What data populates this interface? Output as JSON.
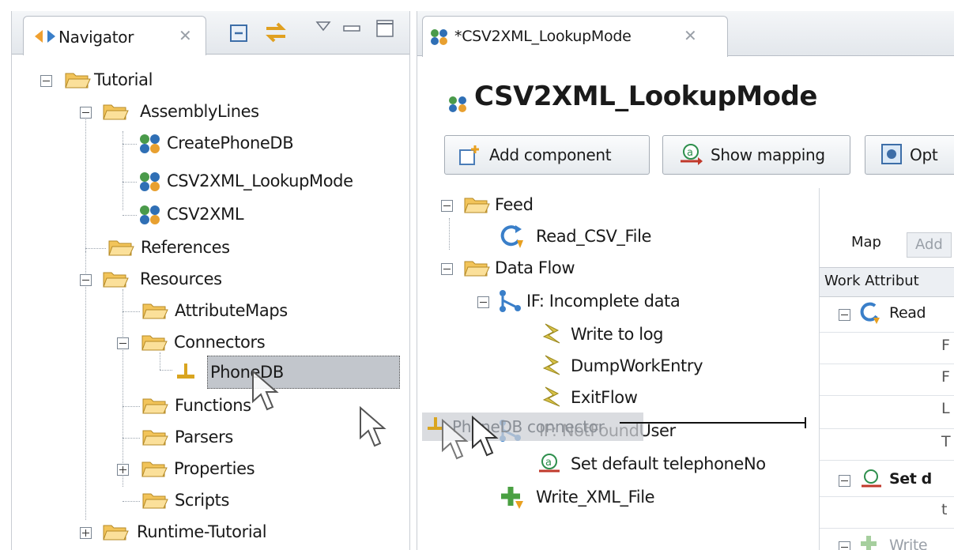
{
  "navigator": {
    "tab_label": "Navigator",
    "tree": [
      {
        "label": "Tutorial"
      },
      {
        "label": "AssemblyLines"
      },
      {
        "label": "CreatePhoneDB"
      },
      {
        "label": "CSV2XML_LookupMode"
      },
      {
        "label": "CSV2XML"
      },
      {
        "label": "References"
      },
      {
        "label": "Resources"
      },
      {
        "label": "AttributeMaps"
      },
      {
        "label": "Connectors"
      },
      {
        "label": "PhoneDB"
      },
      {
        "label": "Functions"
      },
      {
        "label": "Parsers"
      },
      {
        "label": "Properties"
      },
      {
        "label": "Scripts"
      },
      {
        "label": "Runtime-Tutorial"
      }
    ]
  },
  "editor": {
    "tab_label": "*CSV2XML_LookupMode",
    "title": "CSV2XML_LookupMode",
    "toolbar": {
      "add_component": "Add component",
      "show_mapping": "Show mapping",
      "options_partial": "Opt"
    },
    "flow": [
      {
        "label": "Feed"
      },
      {
        "label": "Read_CSV_File"
      },
      {
        "label": "Data Flow"
      },
      {
        "label": "IF: Incomplete data"
      },
      {
        "label": "Write to log"
      },
      {
        "label": "DumpWorkEntry"
      },
      {
        "label": "ExitFlow"
      },
      {
        "label": "IF: NotFoundUser"
      },
      {
        "label": "Set default telephoneNo"
      },
      {
        "label": "Write_XML_File"
      }
    ],
    "drag_ghost": "PhoneDB connector",
    "mapping": {
      "tab_map": "Map",
      "tab_add": "Add",
      "header": "Work Attribut",
      "rows": [
        "Read",
        "F",
        "F",
        "L",
        "T",
        "Set d",
        "t",
        "Write"
      ]
    }
  },
  "colors": {
    "selection": "#c2c6cc",
    "folder": "#f2c45a",
    "accent_blue": "#2f6fb5"
  }
}
